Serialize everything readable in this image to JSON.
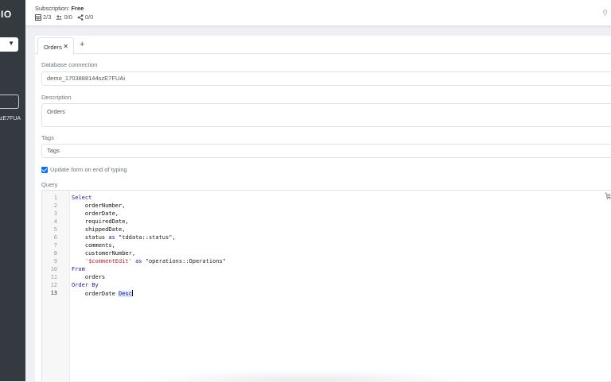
{
  "sidebar": {
    "brand": "IO",
    "database_short": "zE7FUA"
  },
  "topbar": {
    "subscription_label": "Subscription: ",
    "subscription_value": "Free",
    "stats": [
      {
        "icon": "table-icon",
        "value": "2/3"
      },
      {
        "icon": "users-icon",
        "value": "0/0"
      },
      {
        "icon": "share-icon",
        "value": "0/0"
      }
    ]
  },
  "tabs": [
    {
      "label": "Orders",
      "active": true
    }
  ],
  "form": {
    "db_label": "Database connection",
    "db_value": "demo_1703888144szE7FUAi",
    "desc_label": "Description",
    "desc_value": "Orders",
    "tags_label": "Tags",
    "tags_placeholder": "Tags",
    "update_label": "Update form on end of typing",
    "update_checked": true,
    "query_label": "Query"
  },
  "editor": {
    "active_line": 13,
    "lines": [
      [
        {
          "t": "Select",
          "c": "kw"
        }
      ],
      [
        {
          "t": "    orderNumber,"
        }
      ],
      [
        {
          "t": "    orderDate,"
        }
      ],
      [
        {
          "t": "    requiredDate,"
        }
      ],
      [
        {
          "t": "    shippedDate,"
        }
      ],
      [
        {
          "t": "    status "
        },
        {
          "t": "as",
          "c": "kw"
        },
        {
          "t": " \"tddata::status\",",
          "c": "str"
        }
      ],
      [
        {
          "t": "    comments,"
        }
      ],
      [
        {
          "t": "    customerNumber,"
        }
      ],
      [
        {
          "t": "    "
        },
        {
          "t": "'$commentEdit'",
          "c": "tpl"
        },
        {
          "t": " "
        },
        {
          "t": "as",
          "c": "kw"
        },
        {
          "t": " \"operations::Operations\"",
          "c": "str"
        }
      ],
      [
        {
          "t": "From",
          "c": "kw"
        }
      ],
      [
        {
          "t": "    orders"
        }
      ],
      [
        {
          "t": "Order By",
          "c": "kw"
        }
      ],
      [
        {
          "t": "    orderDate "
        },
        {
          "t": "Desc",
          "c": "kw hl"
        }
      ]
    ]
  }
}
